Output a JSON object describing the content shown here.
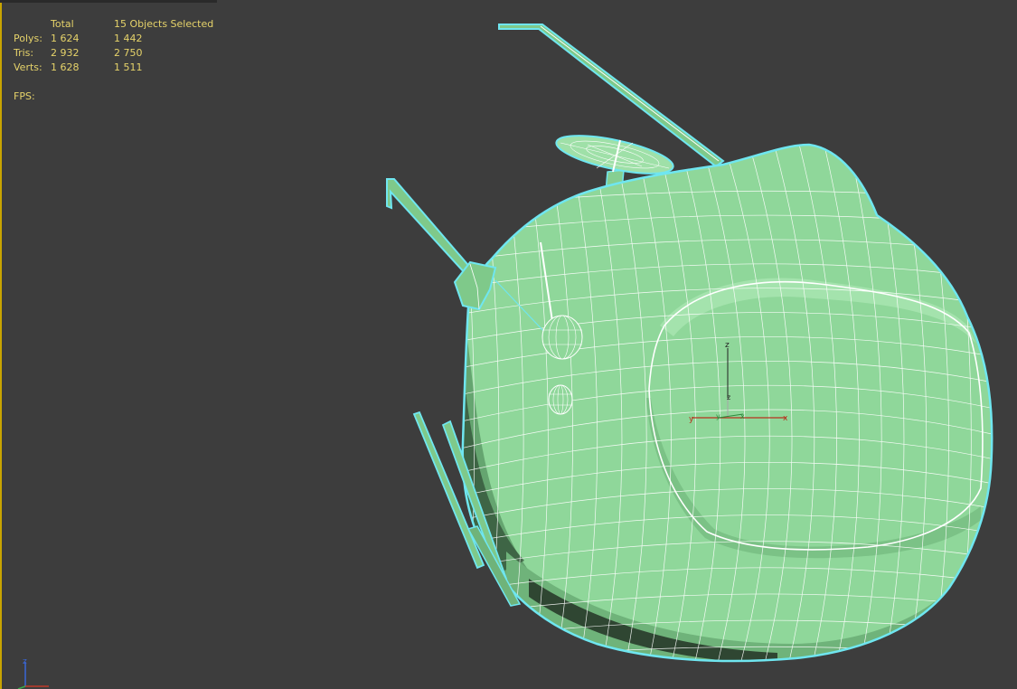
{
  "viewport_stats": {
    "header": {
      "col_total": "Total",
      "col_selected": "15 Objects Selected"
    },
    "rows": [
      {
        "label": "Polys:",
        "total": "1 624",
        "selected": "1 442"
      },
      {
        "label": "Tris:",
        "total": "2 932",
        "selected": "2 750"
      },
      {
        "label": "Verts:",
        "total": "1 628",
        "selected": "1 511"
      }
    ],
    "fps_label": "FPS:"
  },
  "gizmo": {
    "x": "x",
    "y": "y",
    "z": "z"
  },
  "corner_axis": {
    "z": "z"
  },
  "colors": {
    "viewport_bg": "#3d3d3d",
    "stats_text": "#e6d36a",
    "mesh_fill": "#8fd79a",
    "mesh_shade": "#6fb37a",
    "wire": "#ffffff",
    "selection_outline": "#6fe6f0",
    "active_border": "#c8a400"
  },
  "icons": [
    "transform-gizmo-icon",
    "world-axis-icon"
  ]
}
